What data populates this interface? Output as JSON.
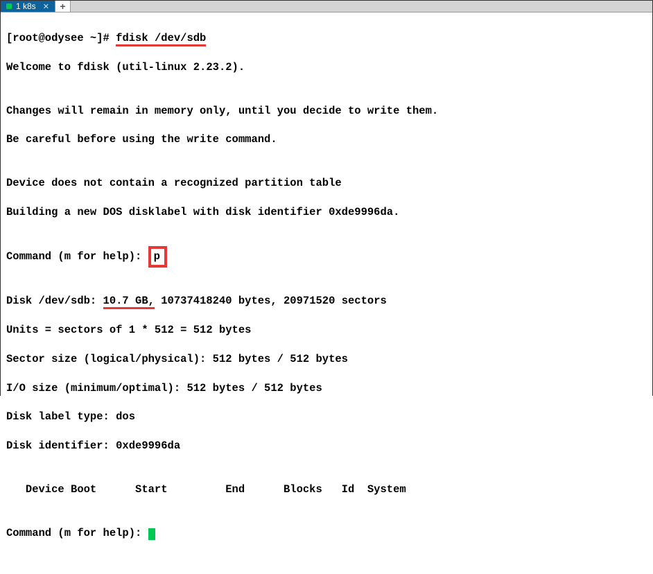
{
  "tabbar": {
    "tab1_label": "1 k8s",
    "new_tab_label": "+"
  },
  "terminal": {
    "prompt_prefix": "[root@odysee ~]# ",
    "command": "fdisk /dev/sdb",
    "welcome_line": "Welcome to fdisk (util-linux 2.23.2).",
    "blank1": "",
    "changes_line": "Changes will remain in memory only, until you decide to write them.",
    "careful_line": "Be careful before using the write command.",
    "blank2": "",
    "notable_line": "Device does not contain a recognized partition table",
    "building_line": "Building a new DOS disklabel with disk identifier 0xde9996da.",
    "blank3": "",
    "cmd_prompt": "Command (m for help): ",
    "cmd_input": "p",
    "blank4": "",
    "disk_prefix": "Disk /dev/sdb: ",
    "disk_size": "10.7 GB,",
    "disk_rest": " 10737418240 bytes, 20971520 sectors",
    "units_line": "Units = sectors of 1 * 512 = 512 bytes",
    "sector_line": "Sector size (logical/physical): 512 bytes / 512 bytes",
    "io_line": "I/O size (minimum/optimal): 512 bytes / 512 bytes",
    "label_line": "Disk label type: dos",
    "ident_line": "Disk identifier: 0xde9996da",
    "blank5": "",
    "header_line": "   Device Boot      Start         End      Blocks   Id  System",
    "blank6": "",
    "cmd_prompt2": "Command (m for help): "
  }
}
